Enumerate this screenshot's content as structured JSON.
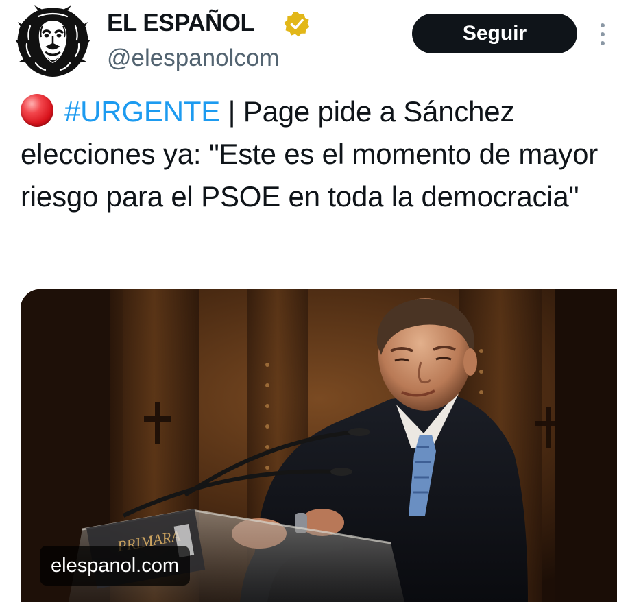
{
  "account": {
    "display_name": "EL ESPAÑOL",
    "handle": "@elespanolcom",
    "verified": true,
    "avatar_icon": "lion-head-logo",
    "verified_badge_color": "#e2b719"
  },
  "actions": {
    "follow_label": "Seguir",
    "more_icon": "vertical-ellipsis-icon"
  },
  "post": {
    "status_icon": "red-circle-emoji",
    "hashtag": "#URGENTE",
    "text": " | Page pide a Sánchez elecciones ya: \"Este es el momento de mayor riesgo para el PSOE en toda la democracia\""
  },
  "media": {
    "source_domain": "elespanol.com",
    "podium_sign_text": "PRIMARA"
  },
  "colors": {
    "text": "#0f1419",
    "secondary_text": "#536471",
    "link": "#1d9bf0",
    "button_bg": "#0f1419",
    "button_text": "#ffffff"
  }
}
